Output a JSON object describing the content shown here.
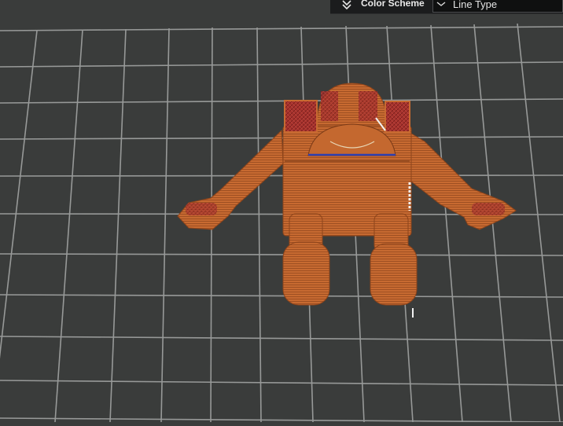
{
  "toolbar": {
    "color_scheme_label": "Color Scheme",
    "color_scheme_icon": "double-chevron-down-icon",
    "color_scheme_value": "Line Type",
    "dropdown_icon": "chevron-down-icon"
  },
  "colors": {
    "viewport_background": "#3a3c3b",
    "grid_lines": "#a8aaa9",
    "model_orange": "#c76a31",
    "infill_red": "#a8332e",
    "travel_blue": "#2e3fb0",
    "toolbar_background": "#1b1c1d"
  }
}
